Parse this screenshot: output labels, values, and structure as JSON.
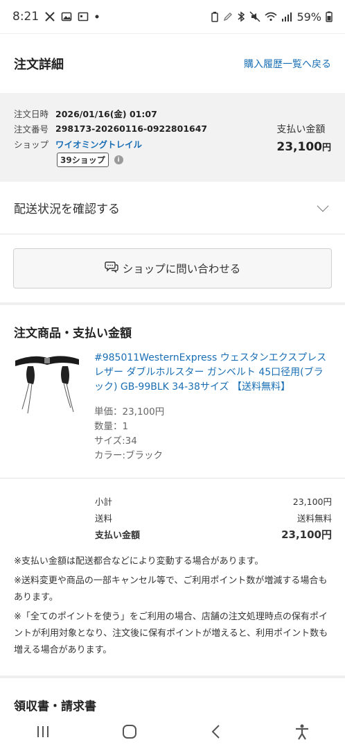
{
  "status_bar": {
    "time": "8:21",
    "battery": "59%"
  },
  "header": {
    "title": "注文詳細",
    "back_link": "購入履歴一覧へ戻る"
  },
  "order": {
    "date_label": "注文日時",
    "date_value": "2026/01/16(金) 01:07",
    "number_label": "注文番号",
    "number_value": "298173-20260116-0922801647",
    "shop_label": "ショップ",
    "shop_value": "ワイオミングトレイル",
    "shop_badge": "39ショップ",
    "pay_label": "支払い金額",
    "pay_amount": "23,100",
    "pay_unit": "円"
  },
  "delivery": {
    "label": "配送状況を確認する"
  },
  "contact": {
    "label": "ショップに問い合わせる"
  },
  "items_section": {
    "title": "注文商品・支払い金額"
  },
  "product": {
    "name": "#985011WesternExpress ウェスタンエクスプレス レザー ダブルホルスター ガンベルト 45口径用(ブラック) GB-99BLK 34-38サイズ 【送料無料】",
    "unit_price": "単価：23,100円",
    "quantity": "数量：1",
    "size": "サイズ:34",
    "color": "カラー:ブラック"
  },
  "totals": {
    "subtotal_label": "小計",
    "subtotal_value": "23,100円",
    "shipping_label": "送料",
    "shipping_value": "送料無料",
    "total_label": "支払い金額",
    "total_value": "23,100円"
  },
  "notes": [
    "※支払い金額は配送都合などにより変動する場合があります。",
    "※送料変更や商品の一部キャンセル等で、ご利用ポイント数が増減する場合もあります。",
    "※「全てのポイントを使う」をご利用の場合、店舗の注文処理時点の保有ポイントが利用対象となり、注文後に保有ポイントが増えると、利用ポイント数も増える場合があります。"
  ],
  "receipt_section": {
    "title": "領収書・請求書"
  },
  "colors": {
    "link": "#1a6fb5",
    "summary_bg": "#f2f2f2"
  }
}
